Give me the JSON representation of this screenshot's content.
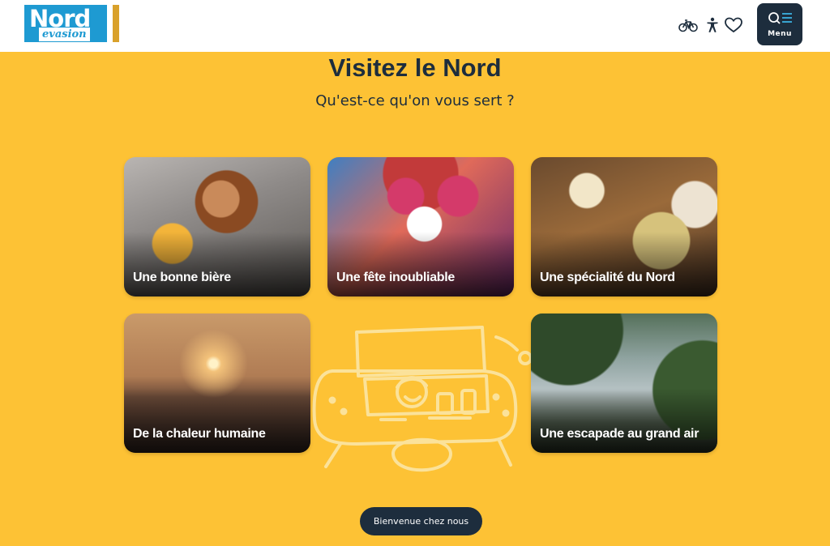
{
  "header": {
    "logo": {
      "line1": "Nord",
      "line2": "evasion"
    },
    "icons": [
      "bike-icon",
      "accessibility-icon",
      "heart-icon"
    ],
    "menu_label": "Menu"
  },
  "main": {
    "title": "Visitez le Nord",
    "subtitle": "Qu'est-ce qu'on vous sert ?",
    "cards": [
      {
        "label": "Une bonne bière"
      },
      {
        "label": "Une fête inoubliable"
      },
      {
        "label": "Une spécialité du Nord"
      },
      {
        "label": "De la chaleur humaine"
      },
      {
        "label": "Une escapade au grand air"
      }
    ],
    "cta_label": "Bienvenue chez nous"
  },
  "colors": {
    "background": "#FDC235",
    "navy": "#1D2D3D",
    "logo_blue": "#1E9AD2",
    "logo_gold": "#D9A12B"
  }
}
